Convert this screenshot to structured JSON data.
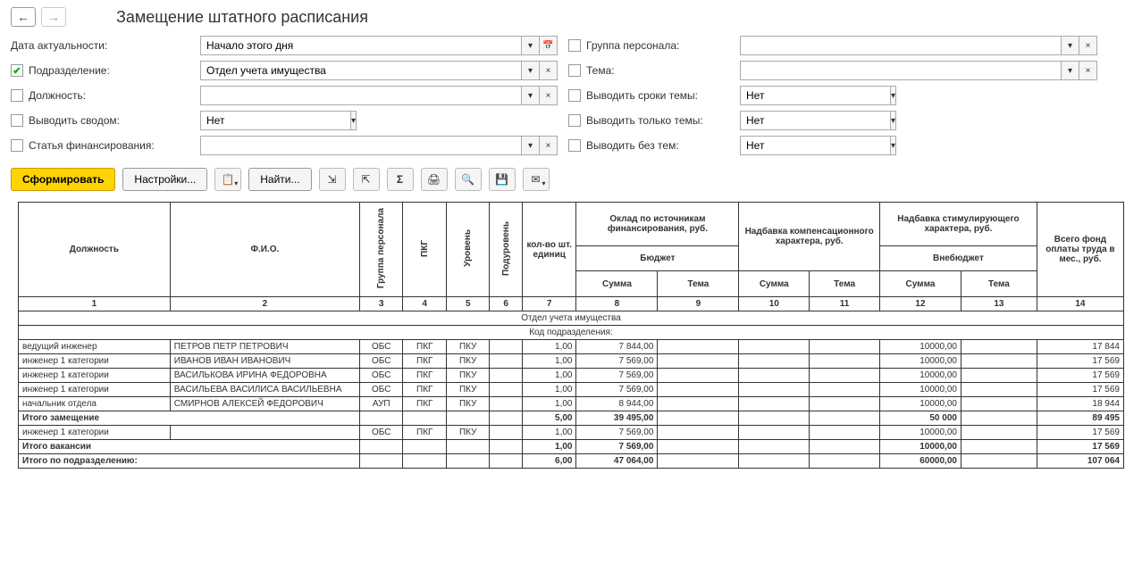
{
  "header": {
    "title": "Замещение штатного расписания"
  },
  "filters": {
    "date_label": "Дата актуальности:",
    "date_value": "Начало этого дня",
    "dept_label": "Подразделение:",
    "dept_value": "Отдел учета имущества",
    "position_label": "Должность:",
    "position_value": "",
    "summary_label": "Выводить сводом:",
    "summary_value": "Нет",
    "finance_label": "Статья финансирования:",
    "finance_value": "",
    "group_label": "Группа персонала:",
    "group_value": "",
    "theme_label": "Тема:",
    "theme_value": "",
    "theme_dates_label": "Выводить сроки темы:",
    "theme_dates_value": "Нет",
    "only_themes_label": "Выводить только темы:",
    "only_themes_value": "Нет",
    "without_themes_label": "Выводить без тем:",
    "without_themes_value": "Нет"
  },
  "toolbar": {
    "generate": "Сформировать",
    "settings": "Настройки...",
    "find": "Найти..."
  },
  "table": {
    "headers": {
      "position": "Должность",
      "fio": "Ф.И.О.",
      "group": "Группа персонала",
      "pkg": "ПКГ",
      "level": "Уровень",
      "sublevel": "Подуровень",
      "units": "кол-во шт. единиц",
      "salary": "Оклад по источникам финансирования, руб.",
      "comp": "Надбавка компенсационного характера, руб.",
      "stim": "Надбавка стимулирующего характера, руб.",
      "total": "Всего фонд оплаты труда в мес., руб.",
      "budget": "Бюджет",
      "offbudget": "Внебюджет",
      "sum": "Сумма",
      "theme": "Тема"
    },
    "colnums": [
      "1",
      "2",
      "3",
      "4",
      "5",
      "6",
      "7",
      "8",
      "9",
      "10",
      "11",
      "12",
      "13",
      "14"
    ],
    "section_title": "Отдел учета имущества",
    "section_code": "Код подразделения:",
    "rows": [
      {
        "pos": "ведущий инженер",
        "fio": "ПЕТРОВ ПЕТР ПЕТРОВИЧ",
        "grp": "ОБС",
        "pkg": "ПКГ",
        "lvl": "ПКУ",
        "sub": "",
        "units": "1,00",
        "sal": "7 844,00",
        "stim": "10000,00",
        "tot": "17 844"
      },
      {
        "pos": "инженер 1 категории",
        "fio": "ИВАНОВ ИВАН ИВАНОВИЧ",
        "grp": "ОБС",
        "pkg": "ПКГ",
        "lvl": "ПКУ",
        "sub": "",
        "units": "1,00",
        "sal": "7 569,00",
        "stim": "10000,00",
        "tot": "17 569"
      },
      {
        "pos": "инженер 1 категории",
        "fio": "ВАСИЛЬКОВА ИРИНА ФЕДОРОВНА",
        "grp": "ОБС",
        "pkg": "ПКГ",
        "lvl": "ПКУ",
        "sub": "",
        "units": "1,00",
        "sal": "7 569,00",
        "stim": "10000,00",
        "tot": "17 569"
      },
      {
        "pos": "инженер 1 категории",
        "fio": "ВАСИЛЬЕВА ВАСИЛИСА ВАСИЛЬЕВНА",
        "grp": "ОБС",
        "pkg": "ПКГ",
        "lvl": "ПКУ",
        "sub": "",
        "units": "1,00",
        "sal": "7 569,00",
        "stim": "10000,00",
        "tot": "17 569"
      },
      {
        "pos": "начальник отдела",
        "fio": "СМИРНОВ АЛЕКСЕЙ ФЕДОРОВИЧ",
        "grp": "АУП",
        "pkg": "ПКГ",
        "lvl": "ПКУ",
        "sub": "",
        "units": "1,00",
        "sal": "8 944,00",
        "stim": "10000,00",
        "tot": "18 944"
      }
    ],
    "subtotal1": {
      "label": "Итого замещение",
      "units": "5,00",
      "sal": "39 495,00",
      "stim": "50 000",
      "tot": "89 495"
    },
    "vacancy": {
      "pos": "инженер 1 категории",
      "grp": "ОБС",
      "pkg": "ПКГ",
      "lvl": "ПКУ",
      "units": "1,00",
      "sal": "7 569,00",
      "stim": "10000,00",
      "tot": "17 569"
    },
    "subtotal2": {
      "label": "Итого вакансии",
      "units": "1,00",
      "sal": "7 569,00",
      "stim": "10000,00",
      "tot": "17 569"
    },
    "grandtotal": {
      "label": "Итого по подразделению:",
      "units": "6,00",
      "sal": "47 064,00",
      "stim": "60000,00",
      "tot": "107 064"
    }
  }
}
